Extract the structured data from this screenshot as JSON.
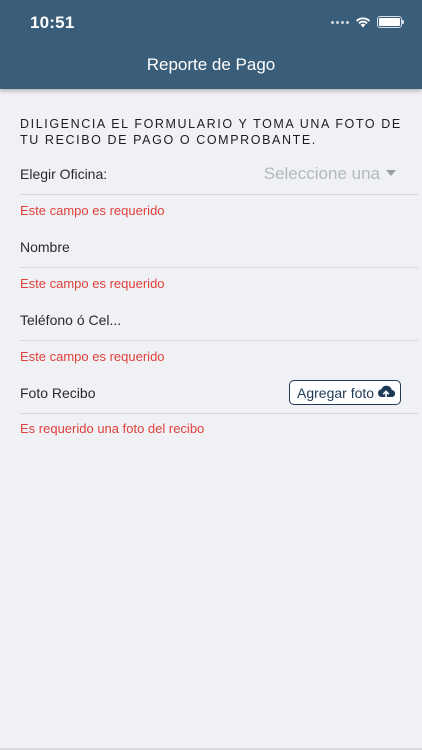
{
  "status_bar": {
    "time": "10:51"
  },
  "nav": {
    "title": "Reporte de Pago"
  },
  "form": {
    "intro": "DILIGENCIA EL FORMULARIO Y TOMA UNA FOTO DE TU RECIBO DE PAGO O COMPROBANTE.",
    "office": {
      "label": "Elegir Oficina:",
      "placeholder": "Seleccione una",
      "error": "Este campo es requerido"
    },
    "name": {
      "label": "Nombre",
      "error": "Este campo es requerido"
    },
    "phone": {
      "label": "Teléfono ó Cel...",
      "error": "Este campo es requerido"
    },
    "photo": {
      "label": "Foto Recibo",
      "button_label": "Agregar foto",
      "error": "Es requerido una foto del recibo"
    }
  },
  "colors": {
    "header": "#3a5d79",
    "error": "#e0403c",
    "button_border": "#1f3a57",
    "background": "#f0f1f4"
  },
  "icons": [
    "wifi-icon",
    "battery-icon",
    "cloud-upload-icon",
    "chevron-down-icon"
  ]
}
